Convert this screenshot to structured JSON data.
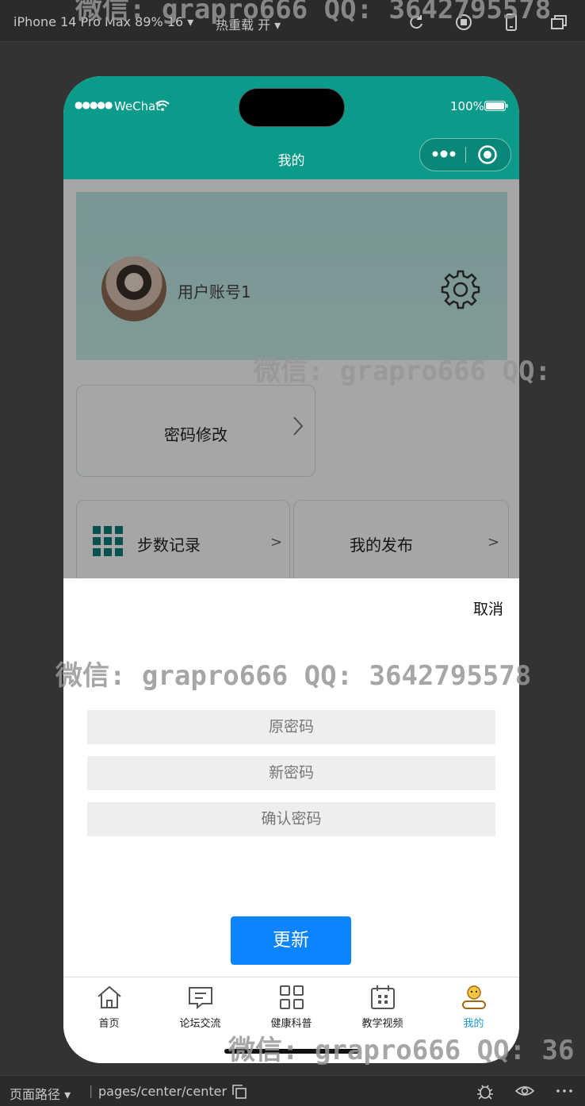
{
  "simulator": {
    "device": "iPhone 14 Pro Max 89% 16 ▾",
    "hot_reload": "热重载 开 ▾",
    "path_label": "页面路径 ▾",
    "path_separator": "|",
    "path": "pages/center/center"
  },
  "statusbar": {
    "signal": "●●●●●",
    "carrier": "WeChat",
    "battery": "100%"
  },
  "navbar": {
    "title": "我的"
  },
  "profile": {
    "username": "用户账号1"
  },
  "menu": {
    "password_change": "密码修改",
    "steps_record": "步数记录",
    "steps_arrow": ">",
    "my_posts": "我的发布",
    "posts_arrow": ">"
  },
  "password_sheet": {
    "cancel": "取消",
    "old_password_placeholder": "原密码",
    "new_password_placeholder": "新密码",
    "confirm_password_placeholder": "确认密码",
    "update_button": "更新"
  },
  "tabbar": {
    "items": [
      {
        "label": "首页",
        "icon": "home-icon"
      },
      {
        "label": "论坛交流",
        "icon": "chat-icon"
      },
      {
        "label": "健康科普",
        "icon": "grid-icon"
      },
      {
        "label": "教学视频",
        "icon": "calendar-icon"
      },
      {
        "label": "我的",
        "icon": "user-icon"
      }
    ],
    "active_index": 4
  },
  "watermark": {
    "top": "微信: grapro666 QQ: 3642795578",
    "middle": "微信: grapro666 QQ:",
    "form": "微信: grapro666 QQ: 3642795578",
    "bottom": "微信: grapro666 QQ: 36"
  },
  "colors": {
    "theme": "#0b9b8a",
    "primary_button": "#0a84ff",
    "active_tab": "#1a9ad6",
    "simulator_bg": "#333333"
  }
}
